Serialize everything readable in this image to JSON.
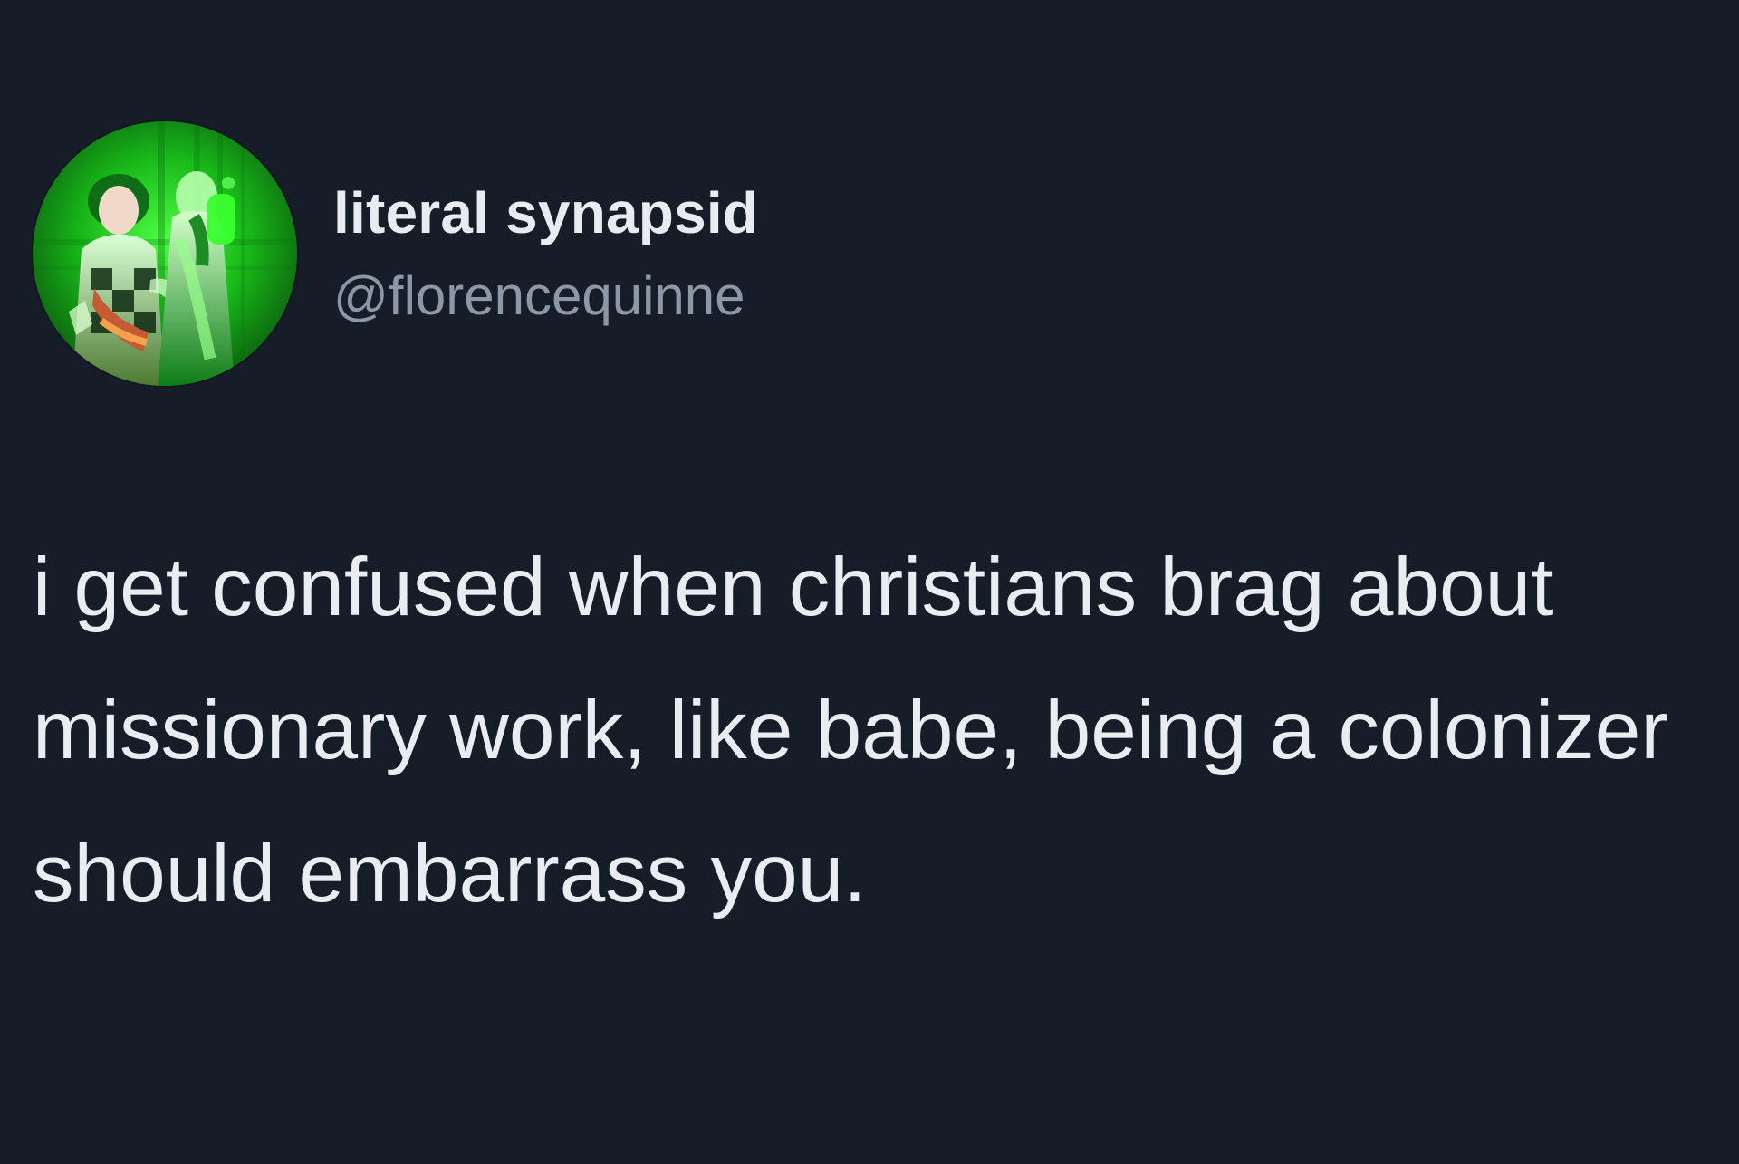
{
  "tweet": {
    "author": {
      "display_name": "literal synapsid",
      "handle": "@florencequinne",
      "avatar_icon": "profile-photo"
    },
    "text": "i get confused when christians brag about missionary work, like babe, being a colonizer should embarrass you."
  },
  "colors": {
    "background": "#171c29",
    "display_name": "#e8ebef",
    "handle": "#8c98a6",
    "tweet_text": "#e9edf1",
    "avatar_accent": "#37ff2f"
  }
}
